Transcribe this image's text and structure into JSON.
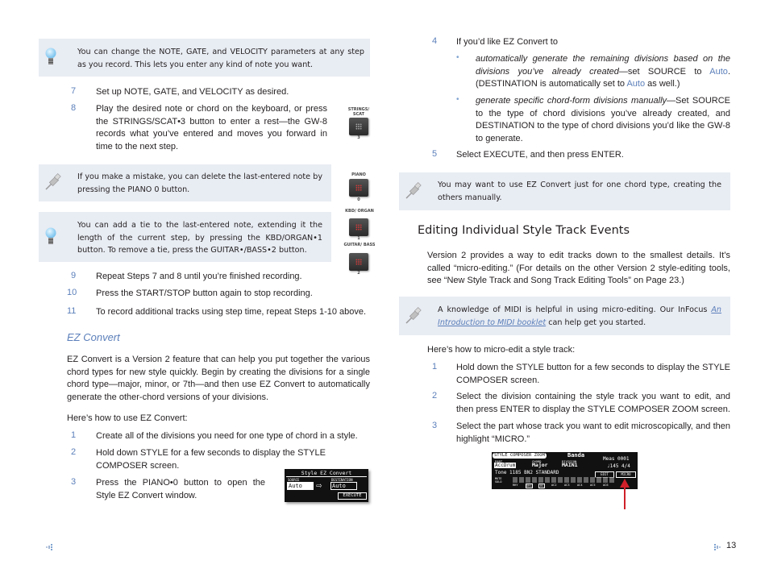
{
  "left": {
    "tip1": {
      "icon": "lightbulb-icon",
      "text": "You can change the NOTE, GATE, and VELOCITY parameters at any step as you record. This lets you enter any kind of note you want."
    },
    "steps_a": [
      {
        "num": "7",
        "text": "Set up NOTE, GATE, and VELOCITY as desired."
      },
      {
        "num": "8",
        "text": "Play the desired note or chord on the keyboard, or press the STRINGS/SCAT•3 button to enter a rest—the GW-8 records what you’ve entered and moves you forward in time to the next step."
      }
    ],
    "tip2": {
      "icon": "pushpin-icon",
      "text": "If you make a mistake, you can delete the last-entered note by pressing the PIANO 0 button."
    },
    "tip3": {
      "icon": "lightbulb-icon",
      "text": "You can add a tie to the last-entered note, extending it the length of the current step, by pressing the KBD/ORGAN•1 button. To remove a tie, press the GUITAR•/BASS•2 button."
    },
    "steps_b": [
      {
        "num": "9",
        "text": "Repeat Steps 7 and 8 until you’re finished recording."
      },
      {
        "num": "10",
        "text": "Press the START/STOP button again to stop recording."
      },
      {
        "num": "11",
        "text": "To record additional tracks using step time, repeat Steps 1-10 above."
      }
    ],
    "subheading": "EZ Convert",
    "intro": "EZ Convert is a Version 2 feature that can help you put together the various chord types for new style quickly. Begin by creating the divisions for a single chord type—major, minor, or 7th—and then use EZ Convert to automatically generate the other-chord versions of your divisions.",
    "howto": "Here’s how to use EZ Convert:",
    "steps_c": [
      {
        "num": "1",
        "text": "Create all of the divisions you need for one type of chord in a style."
      },
      {
        "num": "2",
        "text": "Hold down STYLE for a few seconds to display the STYLE COMPOSER screen."
      },
      {
        "num": "3",
        "text": "Press the PIANO•0 button to open the Style EZ Convert window."
      }
    ],
    "buttons": [
      {
        "caption": "STRINGS/ SCAT",
        "number": "3",
        "lit": false
      },
      {
        "caption": "PIANO",
        "number": "0",
        "lit": true
      },
      {
        "caption": "KBD/ ORGAN",
        "number": "1",
        "lit": true
      },
      {
        "caption": "GUITAR/ BASS",
        "number": "2",
        "lit": true
      }
    ],
    "ez_screen": {
      "title": "Style EZ Convert",
      "source_label": "SOURCE",
      "source_value": "Auto",
      "dest_label": "DESTINATION",
      "dest_value": "Auto",
      "execute": "EXECUTE"
    }
  },
  "right": {
    "step4": {
      "num": "4",
      "text": "If you’d like EZ Convert to"
    },
    "bullet1": {
      "italic": "automatically generate the remaining divisions based on the divisions you’ve already created",
      "rest1": "—set SOURCE to ",
      "auto1": "Auto",
      "rest2": ". (DESTINATION is automatically set to ",
      "auto2": "Auto",
      "rest3": " as well.)"
    },
    "bullet2": {
      "italic": "generate specific chord-form divisions manually",
      "rest": "—Set SOURCE to the type of chord divisions you’ve already created, and DESTINATION to the type of chord divisions you’d like the GW-8 to generate."
    },
    "step5": {
      "num": "5",
      "text": "Select EXECUTE, and then press ENTER."
    },
    "tip4": {
      "icon": "pushpin-icon",
      "text": "You may want to use EZ Convert just for one chord type, creating the others manually."
    },
    "heading": "Editing Individual Style Track Events",
    "para": "Version 2 provides a way to edit tracks down to the smallest details. It’s called “micro-editing.” (For details on the other Version 2 style-editing tools, see “New Style Track and Song Track Editing Tools” on Page 23.)",
    "tip5": {
      "icon": "pushpin-icon",
      "text_before": "A knowledge of MIDI is helpful in using micro-editing. Our InFocus ",
      "link": "An Introduction to MIDI booklet",
      "text_after": " can help get you started."
    },
    "howto": "Here’s how to micro-edit a style track:",
    "steps": [
      {
        "num": "1",
        "text": "Hold down the STYLE button for a few seconds to display the STYLE COMPOSER screen."
      },
      {
        "num": "2",
        "text": "Select the division containing the style track you want to edit, and then press ENTER to display the STYLE COMPOSER ZOOM screen."
      },
      {
        "num": "3",
        "text": "Select the part whose track you want to edit microscopically, and then highlight “MICRO.”"
      }
    ],
    "zoom_screen": {
      "title": "STYLE COMPOSER ZOOM",
      "style_name": "Banda",
      "part_label": "PART",
      "part_value": "AccDrum",
      "chord_label": "CHORD",
      "chord_value": "Major",
      "division_label": "DIVISION",
      "division_value": "MAIN1",
      "meas": "Meas 0001",
      "tempo": "♩145 4/4",
      "tone": "Tone  1185  BN2 STANDARD",
      "edit": "EDIT",
      "micro": "MICRO",
      "mute_label": "MUTE",
      "solo_label": "SOLO",
      "tracks": [
        "RHY",
        "DRS",
        "BS",
        "AC2",
        "AC3",
        "AC4",
        "AC5",
        "AC6"
      ]
    }
  },
  "footer": {
    "left_icon": "prev-page-icon",
    "right_icon": "next-page-icon",
    "page_number": "13"
  },
  "colors": {
    "accent": "#5b7fba",
    "tip_bg": "#e8ecf3",
    "arrow": "#d0202a"
  }
}
